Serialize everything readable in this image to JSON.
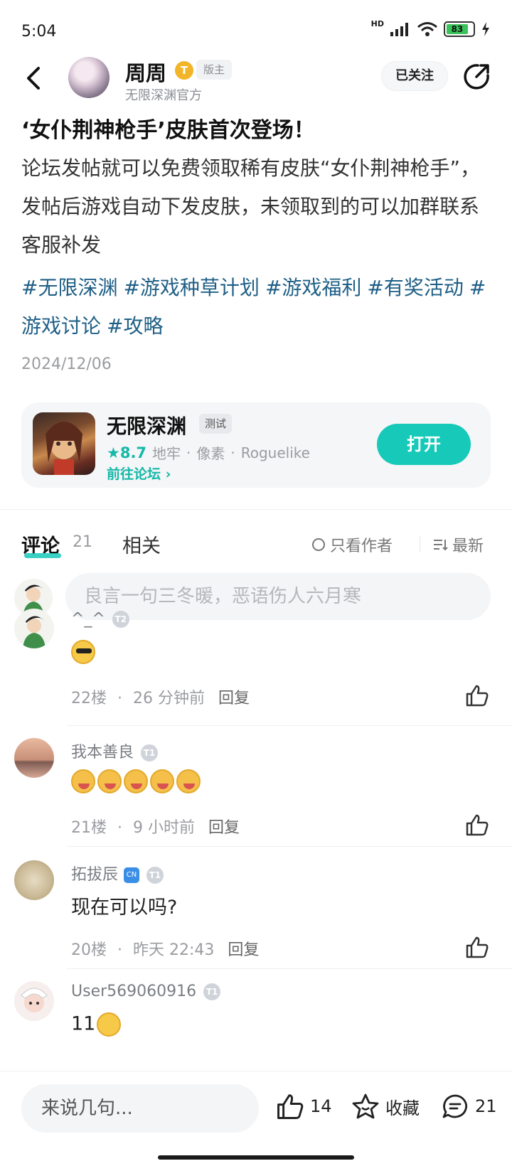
{
  "status_bar": {
    "time": "5:04",
    "network_label": "HD",
    "battery": "83",
    "battery_level": 0.83
  },
  "header": {
    "author_name": "周周",
    "author_badge": "T",
    "mod_tag": "版主",
    "author_sub": "无限深渊官方",
    "follow_label": "已关注"
  },
  "post": {
    "title": "‘女仆荆神枪手’皮肤首次登场！",
    "body": "论坛发帖就可以免费领取稀有皮肤“女仆荆神枪手”，发帖后游戏自动下发皮肤，未领取到的可以加群联系客服补发",
    "tags": [
      "#无限深渊",
      "#游戏种草计划",
      "#游戏福利",
      "#有奖活动",
      "#游戏讨论",
      "#攻略"
    ],
    "date": "2024/12/06"
  },
  "game_card": {
    "name": "无限深渊",
    "test_tag": "测试",
    "rating": "★8.7",
    "genres": [
      "地牢",
      "像素",
      "Roguelike"
    ],
    "sep": "·",
    "forum_link": "前往论坛 ›",
    "open_label": "打开"
  },
  "tabs": {
    "comments_label": "评论",
    "comments_count": "21",
    "related_label": "相关",
    "author_only_label": "只看作者",
    "sort_label": "最新"
  },
  "comment_input": {
    "placeholder": "良言一句三冬暖，恶语伤人六月寒"
  },
  "comments": [
    {
      "name": "^_^",
      "level": "T2",
      "floor": "22楼",
      "time": "26 分钟前",
      "reply": "回复"
    },
    {
      "name": "我本善良",
      "level": "T1",
      "floor": "21楼",
      "time": "9 小时前",
      "reply": "回复"
    },
    {
      "name": "拓拔辰",
      "level": "T1",
      "medal": "CN",
      "text": "现在可以吗?",
      "floor": "20楼",
      "time": "昨天 22:43",
      "reply": "回复"
    },
    {
      "name": "User569060916",
      "level": "T1",
      "text": "11"
    }
  ],
  "bottom_bar": {
    "input_placeholder": "来说几句...",
    "like_count": "14",
    "favorite_label": "收藏",
    "comment_count": "21"
  },
  "colors": {
    "accent": "#16c9b8",
    "tag_link": "#1f5f86",
    "muted": "#9a9ca1"
  },
  "icons": [
    "back-arrow-icon",
    "share-icon",
    "signal-icon",
    "wifi-icon",
    "battery-icon",
    "charging-icon",
    "thumbs-up-icon",
    "star-icon",
    "comment-bubble-icon",
    "circle-icon",
    "sort-icon"
  ]
}
